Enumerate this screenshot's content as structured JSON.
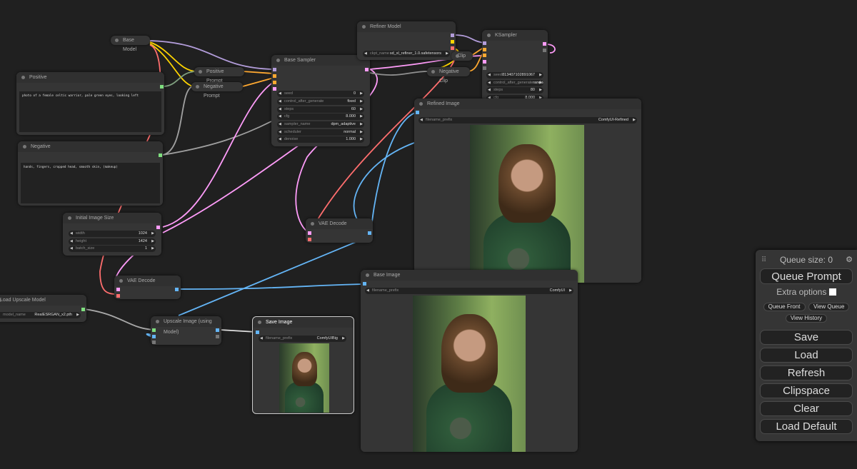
{
  "nodes": {
    "base_model": {
      "title": "Base Model"
    },
    "positive": {
      "title": "Positive",
      "text": "photo of a female celtic warrior, pale   green eyes, looking left"
    },
    "negative": {
      "title": "Negative",
      "text": "hands, fingers, cropped head, smooth skin, (makeup)"
    },
    "positive_prompt": {
      "title": "Positive Prompt"
    },
    "negative_prompt": {
      "title": "Negative Prompt"
    },
    "initial_image_size": {
      "title": "Initial Image Size",
      "widgets": [
        {
          "label": "width",
          "value": "1024"
        },
        {
          "label": "height",
          "value": "1424"
        },
        {
          "label": "batch_size",
          "value": "1"
        }
      ]
    },
    "base_sampler": {
      "title": "Base Sampler",
      "widgets": [
        {
          "label": "seed",
          "value": "0"
        },
        {
          "label": "control_after_generate",
          "value": "fixed"
        },
        {
          "label": "steps",
          "value": "60"
        },
        {
          "label": "cfg",
          "value": "8.000"
        },
        {
          "label": "sampler_name",
          "value": "dpm_adaptive"
        },
        {
          "label": "scheduler",
          "value": "normal"
        },
        {
          "label": "denoise",
          "value": "1.000"
        }
      ]
    },
    "refiner_model": {
      "title": "Refiner Model",
      "widgets": [
        {
          "label": "ckpt_name",
          "value": "sd_xl_refiner_1.0.safetensors"
        }
      ]
    },
    "clip": {
      "title": "Clip"
    },
    "negative_clip": {
      "title": "Negative Clip"
    },
    "ksampler": {
      "title": "KSampler",
      "widgets": [
        {
          "label": "seed",
          "value": "813407102891067"
        },
        {
          "label": "control_after_generate",
          "value": "randomize"
        },
        {
          "label": "steps",
          "value": "80"
        },
        {
          "label": "cfg",
          "value": "8.000"
        }
      ]
    },
    "refined_image": {
      "title": "Refined Image",
      "widgets": [
        {
          "label": "filename_prefix",
          "value": "ComfyUI-Refined"
        }
      ]
    },
    "vae_decode_1": {
      "title": "VAE Decode"
    },
    "vae_decode_2": {
      "title": "VAE Decode"
    },
    "load_upscale_model": {
      "title": "Load Upscale Model",
      "widgets": [
        {
          "label": "model_name",
          "value": "RealESRGAN_x2.pth"
        }
      ]
    },
    "upscale_image": {
      "title": "Upscale Image (using Model)"
    },
    "save_image": {
      "title": "Save Image",
      "widgets": [
        {
          "label": "filename_prefix",
          "value": "ComfyUIBig"
        }
      ]
    },
    "base_image": {
      "title": "Base Image",
      "widgets": [
        {
          "label": "filename_prefix",
          "value": "ComfyUI"
        }
      ]
    }
  },
  "queue_panel": {
    "queue_size": "Queue size: 0",
    "queue_prompt": "Queue Prompt",
    "extra_options": "Extra options",
    "queue_front": "Queue Front",
    "view_queue": "View Queue",
    "view_history": "View History",
    "buttons": [
      "Save",
      "Load",
      "Refresh",
      "Clipspace",
      "Clear",
      "Load Default"
    ]
  },
  "colors": {
    "model": "#b39ddb",
    "clip": "#ffd500",
    "vae": "#ff6e6e",
    "conditioning": "#ffa931",
    "latent": "#ff9cf9",
    "image": "#64b5f6",
    "upscale_model": "#a9a9a9",
    "int": "#7fdf7f"
  }
}
